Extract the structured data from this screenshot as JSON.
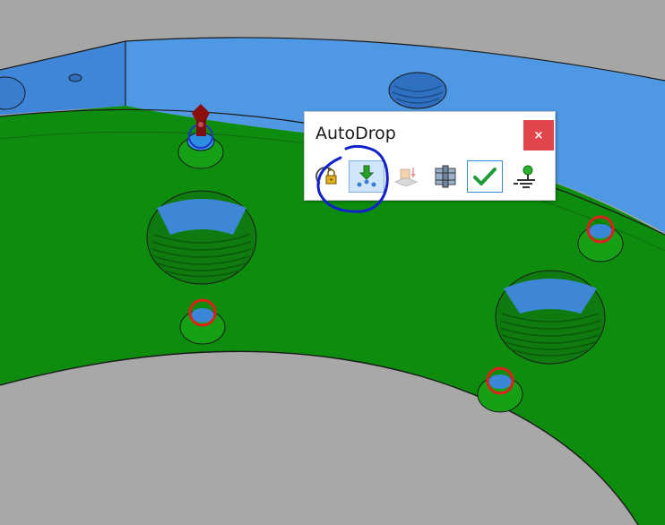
{
  "dialog": {
    "title": "AutoDrop",
    "close_glyph": "×",
    "tools": [
      {
        "name": "rotate-lock-icon",
        "state": "normal"
      },
      {
        "name": "drop-down-arrow-icon",
        "state": "active"
      },
      {
        "name": "layer-stack-icon",
        "state": "disabled"
      },
      {
        "name": "fastener-section-icon",
        "state": "normal"
      },
      {
        "name": "checkmark-icon",
        "state": "checked"
      },
      {
        "name": "ground-connection-icon",
        "state": "normal"
      }
    ]
  },
  "colors": {
    "background": "#a6a6a6",
    "part_green": "#0c8a0c",
    "part_blue": "#4a95e2",
    "highlight_red": "#e0201a",
    "annotation_blue": "#1022c8",
    "close_red": "#e0464b"
  }
}
